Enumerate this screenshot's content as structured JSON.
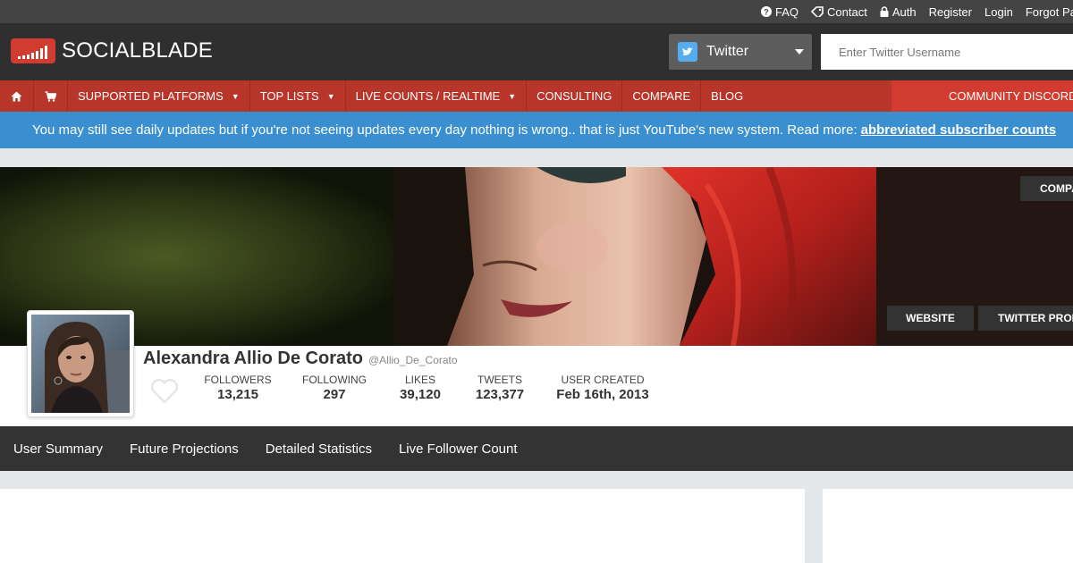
{
  "topbar": {
    "links": [
      {
        "label": "FAQ",
        "icon": "question-circle-icon"
      },
      {
        "label": "Contact",
        "icon": "tag-icon"
      },
      {
        "label": "Auth",
        "icon": "lock-icon"
      },
      {
        "label": "Register"
      },
      {
        "label": "Login"
      },
      {
        "label": "Forgot Pa"
      }
    ]
  },
  "header": {
    "logo_text": "SOCIALBLADE",
    "platform": "Twitter",
    "search_placeholder": "Enter Twitter Username"
  },
  "nav": {
    "items": [
      {
        "label": "SUPPORTED PLATFORMS",
        "dropdown": true
      },
      {
        "label": "TOP LISTS",
        "dropdown": true
      },
      {
        "label": "LIVE COUNTS / REALTIME",
        "dropdown": true
      },
      {
        "label": "CONSULTING"
      },
      {
        "label": "COMPARE"
      },
      {
        "label": "BLOG"
      }
    ],
    "arrow": "▼",
    "discord": "COMMUNITY DISCORD"
  },
  "notice": {
    "text": "You may still see daily updates but if you're not seeing updates every day nothing is wrong.. that is just YouTube's new system. Read more:",
    "link": "abbreviated subscriber counts"
  },
  "banner": {
    "compare": "COMPARE",
    "website": "WEBSITE",
    "profile": "TWITTER PROFILE"
  },
  "profile": {
    "name": "Alexandra Allio De Corato",
    "handle": "@Allio_De_Corato",
    "stats": [
      {
        "label": "FOLLOWERS",
        "value": "13,215"
      },
      {
        "label": "FOLLOWING",
        "value": "297"
      },
      {
        "label": "LIKES",
        "value": "39,120"
      },
      {
        "label": "TWEETS",
        "value": "123,377"
      },
      {
        "label": "USER CREATED",
        "value": "Feb 16th, 2013"
      }
    ]
  },
  "subnav": {
    "items": [
      "User Summary",
      "Future Projections",
      "Detailed Statistics",
      "Live Follower Count"
    ]
  },
  "colors": {
    "nav_red": "#b73529",
    "accent_red": "#d23b2f",
    "notice_blue": "#3a8fd1",
    "header_dark": "#2f2f2f",
    "twitter_blue": "#55acee"
  }
}
